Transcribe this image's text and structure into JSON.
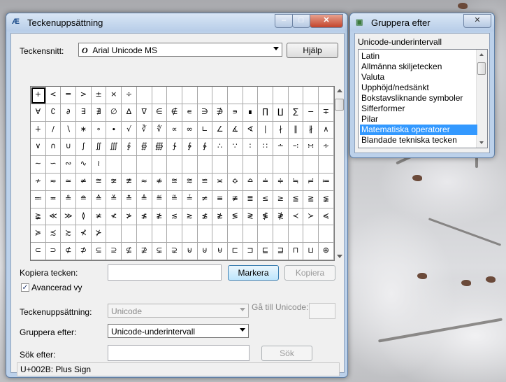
{
  "main_window": {
    "title": "Teckenuppsättning",
    "font_label": "Teckensnitt:",
    "font_value": "Arial Unicode MS",
    "help_button": "Hjälp",
    "characters": [
      "+",
      "<",
      "=",
      ">",
      "±",
      "×",
      "÷",
      "",
      "",
      "",
      "",
      "",
      "",
      "",
      "",
      "",
      "",
      "",
      "",
      "",
      "∀",
      "∁",
      "∂",
      "∃",
      "∄",
      "∅",
      "∆",
      "∇",
      "∈",
      "∉",
      "∊",
      "∋",
      "∌",
      "∍",
      "∎",
      "∏",
      "∐",
      "∑",
      "−",
      "∓",
      "∔",
      "∕",
      "∖",
      "∗",
      "∘",
      "∙",
      "√",
      "∛",
      "∜",
      "∝",
      "∞",
      "∟",
      "∠",
      "∡",
      "∢",
      "∣",
      "∤",
      "∥",
      "∦",
      "∧",
      "∨",
      "∩",
      "∪",
      "∫",
      "∬",
      "∭",
      "∮",
      "∯",
      "∰",
      "∱",
      "∲",
      "∳",
      "∴",
      "∵",
      "∶",
      "∷",
      "∸",
      "∹",
      "∺",
      "∻",
      "∼",
      "∽",
      "∾",
      "∿",
      "≀",
      "",
      "",
      "",
      "",
      "",
      "",
      "",
      "",
      "",
      "",
      "",
      "",
      "",
      "",
      "",
      "≁",
      "≂",
      "≃",
      "≄",
      "≅",
      "≆",
      "≇",
      "≈",
      "≉",
      "≊",
      "≋",
      "≌",
      "≍",
      "≎",
      "≏",
      "≐",
      "≑",
      "≒",
      "≓",
      "≔",
      "≕",
      "≖",
      "≗",
      "≘",
      "≙",
      "≚",
      "≛",
      "≜",
      "≝",
      "≞",
      "≟",
      "≠",
      "≡",
      "≢",
      "≣",
      "≤",
      "≥",
      "≦",
      "≧",
      "≨",
      "≩",
      "≪",
      "≫",
      "≬",
      "≭",
      "≮",
      "≯",
      "≰",
      "≱",
      "≲",
      "≳",
      "≴",
      "≵",
      "≶",
      "≷",
      "≸",
      "≹",
      "≺",
      "≻",
      "≼",
      "≽",
      "≾",
      "≿",
      "⊀",
      "⊁",
      "",
      "",
      "",
      "",
      "",
      "",
      "",
      "",
      "",
      "",
      "",
      "",
      "",
      "",
      "",
      "⊂",
      "⊃",
      "⊄",
      "⊅",
      "⊆",
      "⊇",
      "⊈",
      "⊉",
      "⊊",
      "⊋",
      "⊌",
      "⊍",
      "⊎",
      "⊏",
      "⊐",
      "⊑",
      "⊒",
      "⊓",
      "⊔",
      "⊕"
    ],
    "copy_label": "Kopiera tecken:",
    "copy_value": "",
    "select_button": "Markera",
    "copy_button": "Kopiera",
    "advanced_label": "Avancerad vy",
    "advanced_checked": "✓",
    "charset_label": "Teckenuppsättning:",
    "charset_value": "Unicode",
    "goto_label": "Gå till Unicode:",
    "group_label": "Gruppera efter:",
    "group_value": "Unicode-underintervall",
    "search_label": "Sök efter:",
    "search_value": "",
    "search_button": "Sök",
    "status": "U+002B: Plus Sign"
  },
  "group_window": {
    "title": "Gruppera efter",
    "header": "Unicode-underintervall",
    "items": [
      "Latin",
      "Allmänna skiljetecken",
      "Valuta",
      "Upphöjd/nedsänkt",
      "Bokstavsliknande symboler",
      "Sifferformer",
      "Pilar",
      "Matematiska operatorer",
      "Blandade tekniska tecken"
    ],
    "selected_index": 7
  }
}
